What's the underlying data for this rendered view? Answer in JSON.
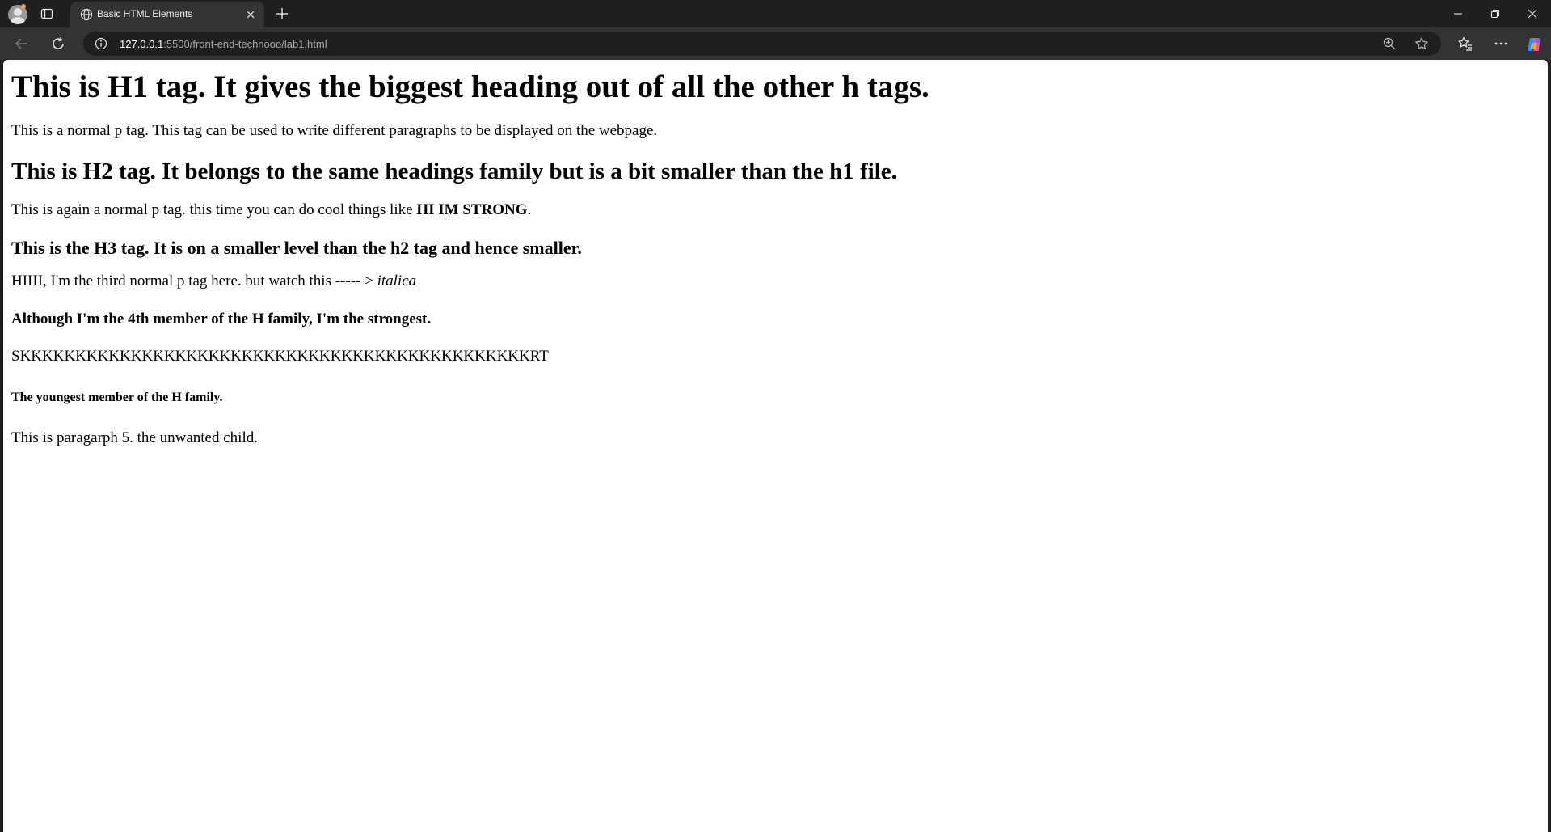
{
  "browser": {
    "tab": {
      "title": "Basic HTML Elements"
    },
    "address": {
      "host": "127.0.0.1",
      "rest": ":5500/front-end-technooo/lab1.html"
    }
  },
  "page": {
    "h1": "This is H1 tag. It gives the biggest heading out of all the other h tags.",
    "p1": "This is a normal p tag. This tag can be used to write different paragraphs to be displayed on the webpage.",
    "h2": "This is H2 tag. It belongs to the same headings family but is a bit smaller than the h1 file.",
    "p2_text": "This is again a normal p tag. this time you can do cool things like ",
    "p2_strong": "HI IM STRONG",
    "p2_end": ".",
    "h3": "This is the H3 tag. It is on a smaller level than the h2 tag and hence smaller.",
    "p3_text": "HIIII, I'm the third normal p tag here. but watch this ----- > ",
    "p3_em": "italica",
    "h4": "Although I'm the 4th member of the H family, I'm the strongest.",
    "h5": "SKKKKKKKKKKKKKKKKKKKKKKKKKKKKKKKKKKKKKKKKKKKKKKRT",
    "h6": "The youngest member of the H family.",
    "p5": "This is paragarph 5. the unwanted child."
  }
}
